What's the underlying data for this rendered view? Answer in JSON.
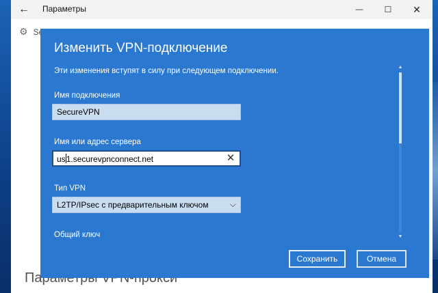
{
  "window": {
    "title": "Параметры",
    "back_icon": "←",
    "minimize_icon": "—",
    "maximize_icon": "☐",
    "close_icon": "✕"
  },
  "background": {
    "item_label": "SecureVPN",
    "heading": "Параметры VPN-прокси"
  },
  "dialog": {
    "title": "Изменить VPN-подключение",
    "subtitle": "Эти изменения вступят в силу при следующем подключении.",
    "connection_name": {
      "label": "Имя подключения",
      "value": "SecureVPN"
    },
    "server": {
      "label": "Имя или адрес сервера",
      "value_before_caret": "us",
      "value_after_caret": "1.securevpnconnect.net",
      "clear_icon": "✕"
    },
    "vpn_type": {
      "label": "Тип VPN",
      "selected": "L2TP/IPsec с предварительным ключом",
      "chevron_icon": "⌵"
    },
    "shared_key": {
      "label": "Общий ключ"
    },
    "buttons": {
      "save": "Сохранить",
      "cancel": "Отмена"
    },
    "scrollbar": {
      "up_icon": "▲",
      "down_icon": "▼"
    }
  }
}
